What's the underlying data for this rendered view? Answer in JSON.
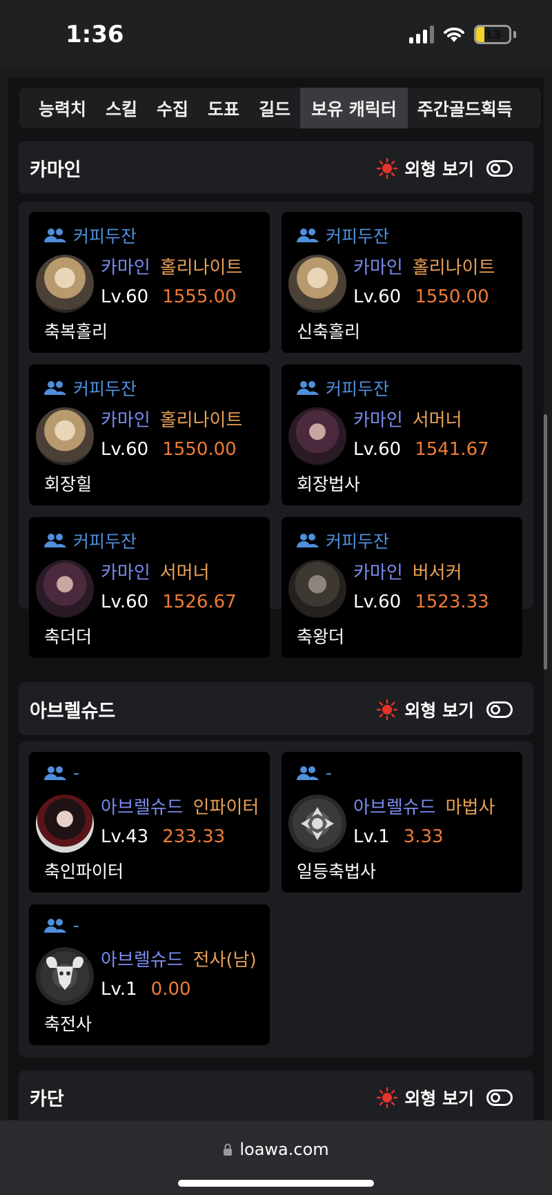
{
  "status_bar": {
    "time": "1:36",
    "battery": "13"
  },
  "tabs": [
    "능력치",
    "스킬",
    "수집",
    "도표",
    "길드",
    "보유 캐릭터",
    "주간골드획득"
  ],
  "active_tab": "보유 캐릭터",
  "look_label": "외형 보기",
  "sections": [
    {
      "title": "카마인",
      "characters": [
        {
          "guild": "커피두잔",
          "server": "카마인",
          "class": "홀리나이트",
          "level": "Lv.60",
          "item_level": "1555.00",
          "name": "축복홀리",
          "avatar": "holy-knight"
        },
        {
          "guild": "커피두잔",
          "server": "카마인",
          "class": "홀리나이트",
          "level": "Lv.60",
          "item_level": "1550.00",
          "name": "신축홀리",
          "avatar": "holy-knight"
        },
        {
          "guild": "커피두잔",
          "server": "카마인",
          "class": "홀리나이트",
          "level": "Lv.60",
          "item_level": "1550.00",
          "name": "회장힐",
          "avatar": "holy-knight"
        },
        {
          "guild": "커피두잔",
          "server": "카마인",
          "class": "서머너",
          "level": "Lv.60",
          "item_level": "1541.67",
          "name": "회장법사",
          "avatar": "summoner"
        },
        {
          "guild": "커피두잔",
          "server": "카마인",
          "class": "서머너",
          "level": "Lv.60",
          "item_level": "1526.67",
          "name": "축더더",
          "avatar": "summoner"
        },
        {
          "guild": "커피두잔",
          "server": "카마인",
          "class": "버서커",
          "level": "Lv.60",
          "item_level": "1523.33",
          "name": "축왕더",
          "avatar": "berserker"
        }
      ]
    },
    {
      "title": "아브렐슈드",
      "characters": [
        {
          "guild": "-",
          "server": "아브렐슈드",
          "class": "인파이터",
          "level": "Lv.43",
          "item_level": "233.33",
          "name": "축인파이터",
          "avatar": "infighter"
        },
        {
          "guild": "-",
          "server": "아브렐슈드",
          "class": "마법사",
          "level": "Lv.1",
          "item_level": "3.33",
          "name": "일등축법사",
          "avatar": "mage-emblem"
        },
        {
          "guild": "-",
          "server": "아브렐슈드",
          "class": "전사(남)",
          "level": "Lv.1",
          "item_level": "0.00",
          "name": "축전사",
          "avatar": "warrior-emblem"
        }
      ]
    },
    {
      "title": "카단",
      "characters": []
    }
  ],
  "url": "loawa.com"
}
